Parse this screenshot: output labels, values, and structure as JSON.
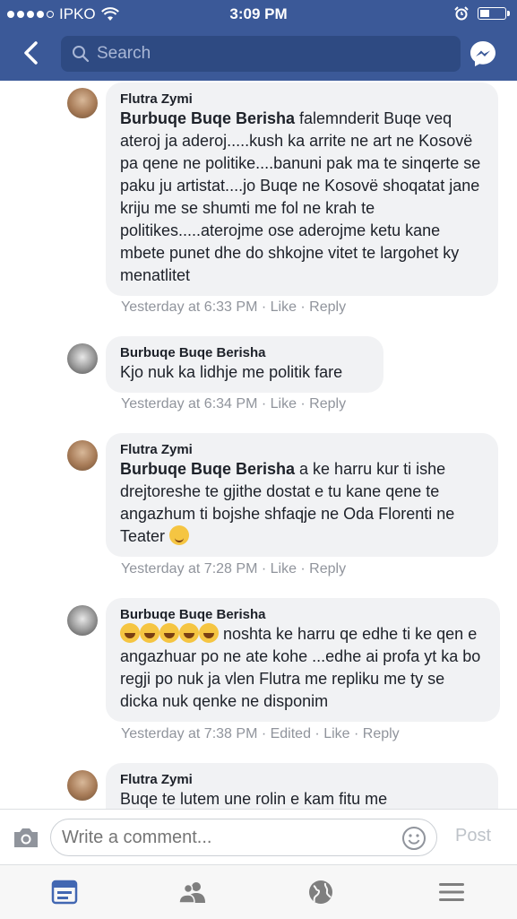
{
  "status_bar": {
    "carrier": "IPKO",
    "time": "3:09 PM"
  },
  "search": {
    "placeholder": "Search"
  },
  "comments": [
    {
      "author": "Flutra Zymi",
      "mention": "Burbuqe Buqe Berisha",
      "text": " falemnderit Buqe veq ateroj ja aderoj.....kush ka arrite ne art ne Kosovë pa qene ne politike....banuni pak ma te sinqerte se paku ju artistat....jo Buqe ne Kosovë shoqatat jane kriju me se shumti me fol ne krah te politikes.....aterojme ose aderojme ketu kane mbete punet dhe do shkojne vitet te largohet ky menatlitet",
      "meta": "Yesterday at 6:33 PM · Like · Reply"
    },
    {
      "author": "Burbuqe Buqe Berisha",
      "text": "Kjo nuk ka lidhje me politik fare",
      "meta": "Yesterday at 6:34 PM · Like · Reply"
    },
    {
      "author": "Flutra Zymi",
      "mention": "Burbuqe Buqe Berisha",
      "text": " a ke harru kur ti ishe drejtoreshe te gjithe dostat e tu kane qene te angazhum ti bojshe shfaqje ne Oda Florenti ne Teater",
      "meta": "Yesterday at 7:28 PM · Like · Reply"
    },
    {
      "author": "Burbuqe Buqe Berisha",
      "text": " noshta ke harru qe edhe ti ke qen e angazhuar po ne ate kohe ...edhe ai profa yt ka bo regji po nuk ja vlen Flutra me repliku me ty se dicka nuk qenke ne disponim",
      "meta": "Yesterday at 7:38 PM · Edited · Like · Reply"
    },
    {
      "author": "Flutra Zymi",
      "text": "Buqe te lutem une rolin e kam fitu me"
    }
  ],
  "composer": {
    "placeholder": "Write a comment...",
    "post_label": "Post"
  },
  "tabs": [
    "news-feed",
    "friends",
    "globe",
    "menu"
  ],
  "colors": {
    "brand": "#3b5998",
    "bubble": "#f1f2f4",
    "active_tab": "#4267b2"
  }
}
